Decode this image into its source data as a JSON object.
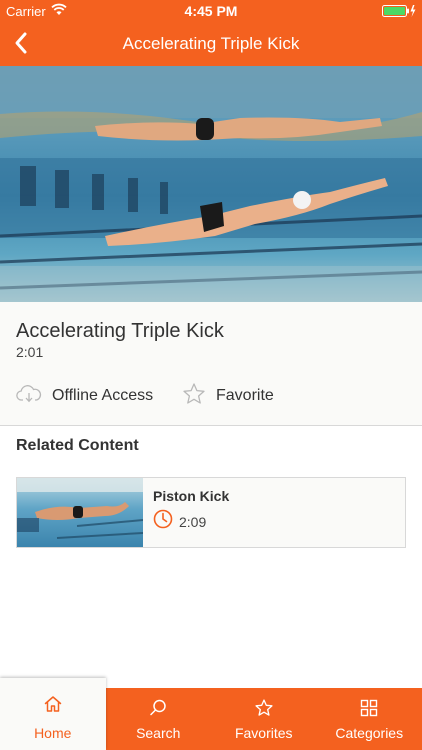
{
  "status_bar": {
    "carrier": "Carrier",
    "time": "4:45 PM",
    "wifi_icon": "wifi-icon",
    "battery_icon": "battery-charging-icon"
  },
  "nav": {
    "title": "Accelerating Triple Kick",
    "back_icon": "chevron-left-icon"
  },
  "video": {
    "title": "Accelerating Triple Kick",
    "duration": "2:01",
    "thumbnail": "underwater-swimmers-image"
  },
  "actions": {
    "offline_label": "Offline Access",
    "offline_icon": "cloud-download-icon",
    "favorite_label": "Favorite",
    "favorite_icon": "star-outline-icon"
  },
  "related": {
    "heading": "Related Content",
    "items": [
      {
        "title": "Piston Kick",
        "duration": "2:09",
        "icon": "clock-icon",
        "thumbnail": "underwater-swimmer-image"
      }
    ]
  },
  "tabs": [
    {
      "label": "Home",
      "icon": "home-icon",
      "selected": true
    },
    {
      "label": "Search",
      "icon": "search-icon",
      "selected": false
    },
    {
      "label": "Favorites",
      "icon": "star-outline-icon",
      "selected": false
    },
    {
      "label": "Categories",
      "icon": "grid-icon",
      "selected": false
    }
  ],
  "colors": {
    "accent": "#f4611f",
    "background": "#fafaf8",
    "border": "#d8d8d8",
    "text": "#333333"
  }
}
